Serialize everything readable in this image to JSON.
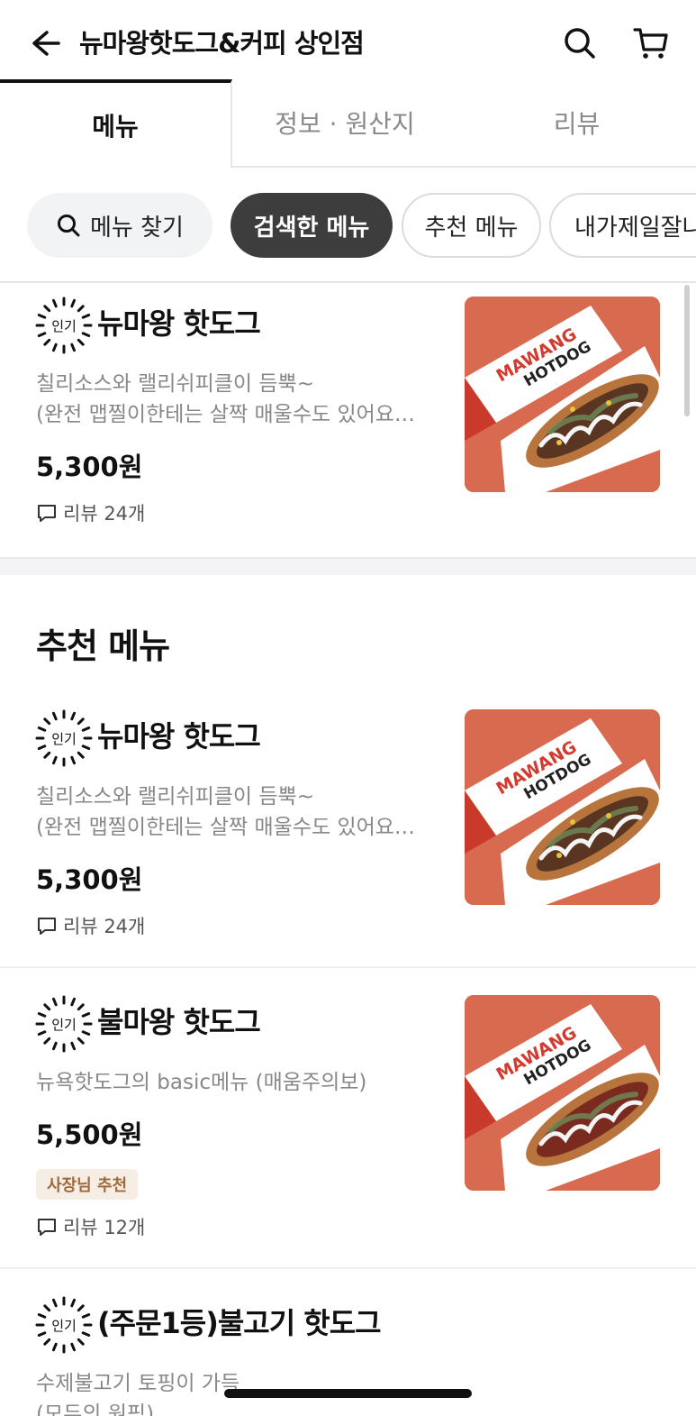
{
  "header": {
    "title": "뉴마왕핫도그&커피 상인점"
  },
  "tabs": [
    {
      "label": "메뉴"
    },
    {
      "label": "정보 · 원산지"
    },
    {
      "label": "리뷰"
    }
  ],
  "chips": {
    "search": "메뉴 찾기",
    "searched": "검색한 메뉴",
    "recommend": "추천 메뉴",
    "best": "내가제일잘나"
  },
  "badge_text": "인기",
  "searched_item": {
    "name": "뉴마왕 핫도그",
    "desc_line1": "칠리소스와 랠리쉬피클이 듬뿍~",
    "desc_line2": "(완전 맵찔이한테는 살짝 매울수도 있어요…",
    "price": "5,300원",
    "reviews": "리뷰 24개"
  },
  "recommend_section": {
    "title": "추천 메뉴",
    "items": [
      {
        "name": "뉴마왕 핫도그",
        "desc_line1": "칠리소스와 랠리쉬피클이 듬뿍~",
        "desc_line2": "(완전 맵찔이한테는 살짝 매울수도 있어요…",
        "price": "5,300원",
        "reviews": "리뷰 24개"
      },
      {
        "name": "불마왕 핫도그",
        "desc_line1": "뉴욕핫도그의 basic메뉴 (매움주의보)",
        "price": "5,500원",
        "owner_badge": "사장님 추천",
        "reviews": "리뷰 12개"
      },
      {
        "name": "(주문1등)불고기 핫도그",
        "desc_line1": "수제불고기 토핑이 가득",
        "desc_line2": "(모두의 원픽)"
      }
    ]
  },
  "image_text": {
    "brand": "MAWANG",
    "product": "HOTDOG"
  },
  "colors": {
    "accent_dark": "#3d3d3d",
    "owner_badge_bg": "#f6eee5",
    "owner_badge_text": "#a0693a",
    "photo_bg": "#d76a4f"
  }
}
